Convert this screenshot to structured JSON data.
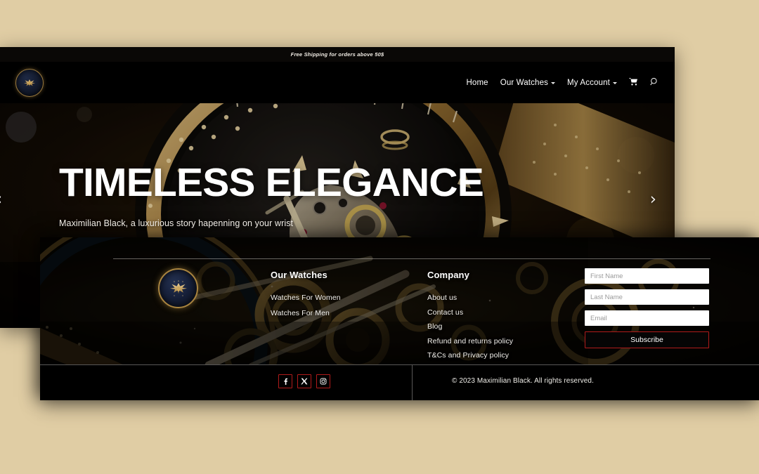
{
  "page": {
    "background_color": "#e0cda4",
    "brand_name": "Maximilian Black"
  },
  "announcement": {
    "text": "Free Shipping for orders above 50$"
  },
  "header": {
    "logo_icon": "eagle-emblem-icon",
    "nav": [
      {
        "label": "Home",
        "has_dropdown": false
      },
      {
        "label": "Our Watches",
        "has_dropdown": true
      },
      {
        "label": "My Account",
        "has_dropdown": true
      }
    ],
    "cart_icon": "shopping-cart-icon",
    "search_icon": "search-icon"
  },
  "hero": {
    "title": "TIMELESS ELEGANCE",
    "subtitle": "Maximilian Black, a luxurious story hapenning on your wrist",
    "prev_arrow": "‹",
    "next_arrow": "›",
    "image_alt": "luxury-watch-closeup"
  },
  "footer": {
    "logo_icon": "eagle-emblem-icon",
    "background_alt": "watch-movement-gears",
    "columns": [
      {
        "heading": "Our Watches",
        "links": [
          "Watches For Women",
          "Watches For Men"
        ]
      },
      {
        "heading": "Company",
        "links": [
          "About us",
          "Contact us",
          "Blog",
          "Refund and returns policy",
          "T&Cs and Privacy policy"
        ]
      }
    ],
    "subscribe": {
      "first_name_placeholder": "First Name",
      "last_name_placeholder": "Last Name",
      "email_placeholder": "Email",
      "first_name_value": "",
      "last_name_value": "",
      "email_value": "",
      "button_label": "Subscribe",
      "accent_color": "#b01b1b"
    },
    "social": [
      {
        "name": "facebook",
        "glyph": "f"
      },
      {
        "name": "x-twitter",
        "glyph": "X"
      },
      {
        "name": "instagram",
        "glyph": "▣"
      }
    ],
    "copyright": "© 2023 Maximilian Black. All rights reserved."
  }
}
